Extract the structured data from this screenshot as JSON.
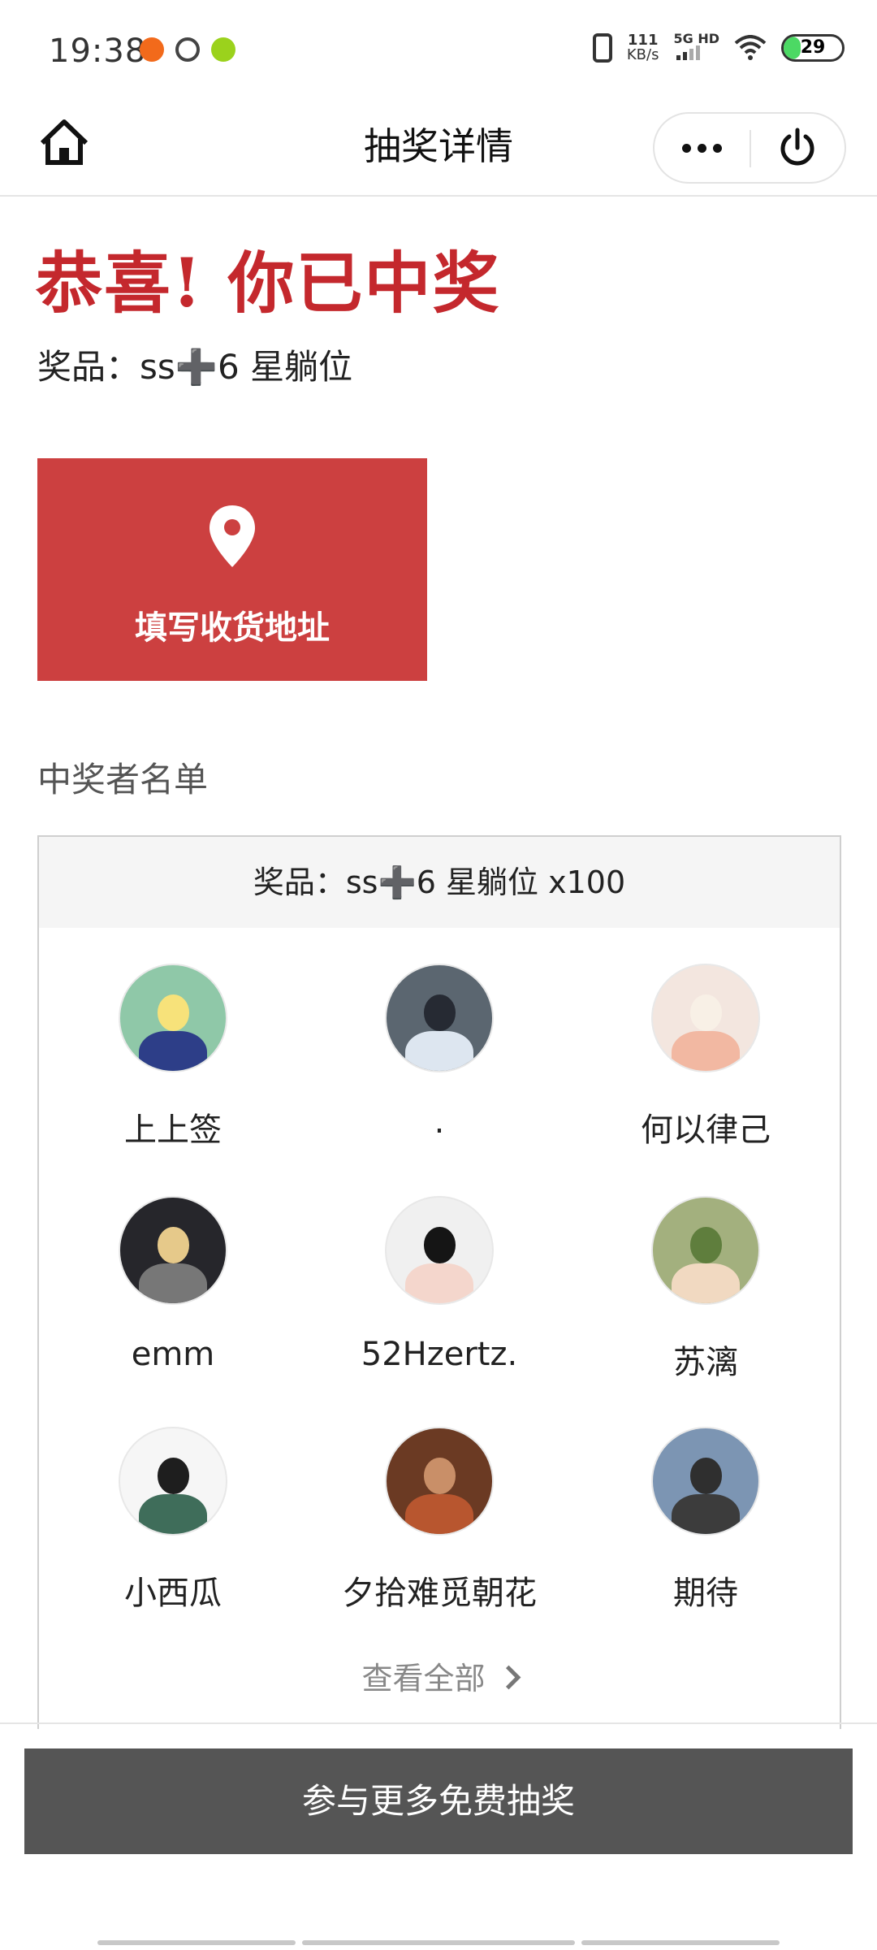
{
  "status_bar": {
    "time": "19:38",
    "network_speed_value": "111",
    "network_speed_unit": "KB/s",
    "signal_label": "5G HD",
    "battery_level": "29",
    "battery_fraction": 0.29,
    "app_icons": [
      "taobao-icon",
      "link-icon",
      "xbox-icon"
    ]
  },
  "nav": {
    "title": "抽奖详情",
    "home_icon": "home-icon",
    "more_icon": "more-dots-icon",
    "power_icon": "power-icon"
  },
  "result": {
    "headline": "恭喜! 你已中奖",
    "prize_line": "奖品：ss➕6 星躺位"
  },
  "address_button": {
    "label": "填写收货地址",
    "icon": "location-pin-icon"
  },
  "winners": {
    "section_label": "中奖者名单",
    "header": "奖品：ss➕6 星躺位 x100",
    "items": [
      {
        "name": "上上签"
      },
      {
        "name": "."
      },
      {
        "name": "何以律己"
      },
      {
        "name": "emm"
      },
      {
        "name": "52Hzertz."
      },
      {
        "name": "苏漓"
      },
      {
        "name": "小西瓜"
      },
      {
        "name": "夕拾难觅朝花"
      },
      {
        "name": "期待"
      }
    ],
    "view_all_label": "查看全部"
  },
  "bottom_button": {
    "label": "参与更多免费抽奖"
  },
  "colors": {
    "accent_red": "#c4282d",
    "address_button_bg": "#cc4040",
    "bottom_button_bg": "#555555",
    "battery_green": "#4cd964"
  }
}
